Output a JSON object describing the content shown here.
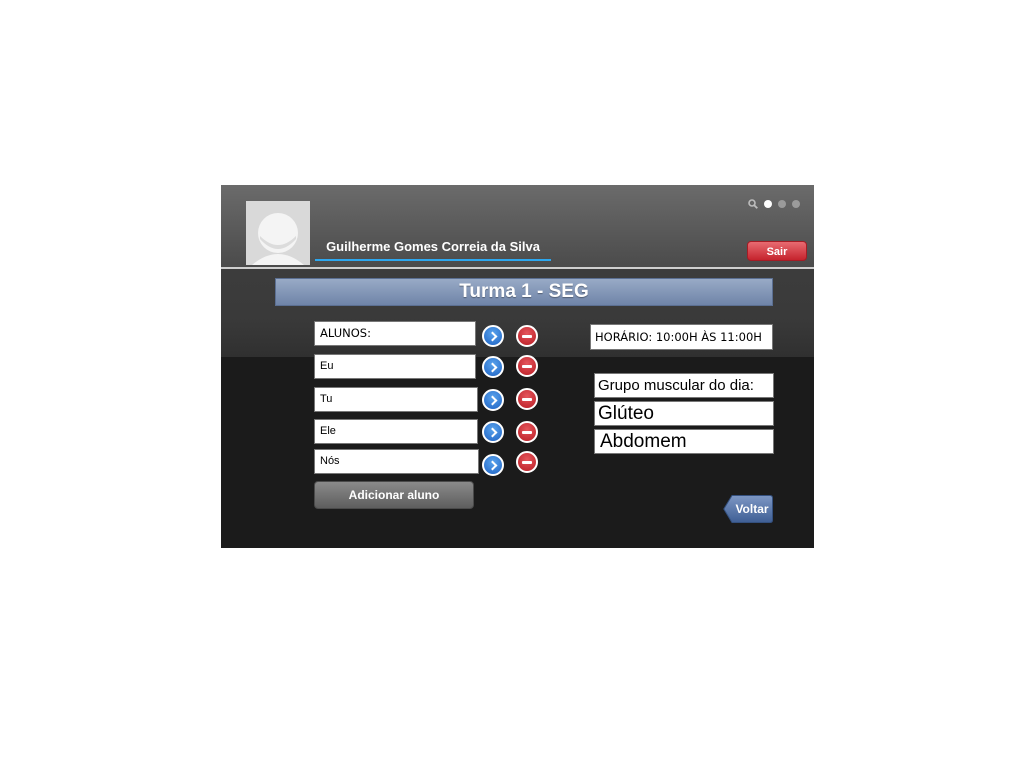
{
  "header": {
    "username": "Guilherme Gomes Correia da Silva",
    "logout_label": "Sair",
    "page_indicator": {
      "count": 3,
      "active": 1
    }
  },
  "main": {
    "title": "Turma 1 - SEG",
    "students_header": "ALUNOS:",
    "students": [
      "Eu",
      "Tu",
      "Ele",
      "Nós"
    ],
    "add_student_label": "Adicionar aluno",
    "schedule": "HORÁRIO: 10:00H ÀS 11:00H",
    "muscle_group_label": "Grupo muscular do dia:",
    "muscle_groups": [
      "Glúteo",
      "Abdomem"
    ],
    "back_label": "Voltar"
  },
  "colors": {
    "accent": "#2da8f0",
    "title_bar": "#7e92b4",
    "logout": "#d23a42",
    "go_button": "#2a6fd0",
    "remove_button": "#c4262e"
  }
}
